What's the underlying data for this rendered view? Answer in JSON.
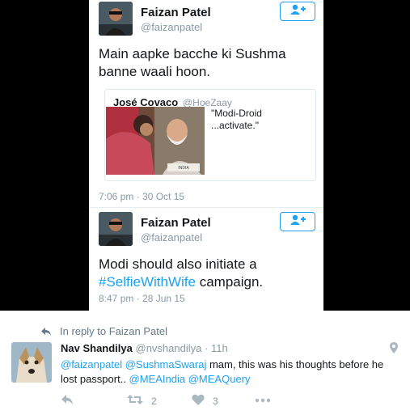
{
  "tweet1": {
    "name": "Faizan Patel",
    "handle": "@faizanpatel",
    "text": "Main aapke bacche ki Sushma banne waali hoon.",
    "quote": {
      "name": "José Covaco",
      "handle": "@HoeZaay",
      "text": "\"Modi-Droid ...activate.\"",
      "image_label": "INDIA"
    },
    "timestamp": "7:06 pm · 30 Oct 15"
  },
  "tweet2": {
    "name": "Faizan Patel",
    "handle": "@faizanpatel",
    "text_before": "Modi should also initiate a",
    "hashtag": "#SelfieWithWife",
    "text_after": " campaign.",
    "timestamp": "8:47 pm · 28 Jun 15"
  },
  "reply": {
    "context": "In reply to Faizan Patel",
    "name": "Nav Shandilya",
    "handle": "@nvshandilya",
    "time": "11h",
    "mention1": "@faizanpatel",
    "mention2": "@SushmaSwaraj",
    "text_mid": " mam, this was his thoughts before he lost passport.. ",
    "mention3": "@MEAIndia",
    "mention4": "@MEAQuery",
    "retweet_count": "2",
    "like_count": "3"
  },
  "colors": {
    "accent": "#1da1f2",
    "muted": "#8899a6",
    "frame": "#000000"
  },
  "icons": [
    "follow-icon",
    "reply-arrow-icon",
    "reply-icon",
    "retweet-icon",
    "like-icon",
    "more-icon",
    "location-icon"
  ]
}
